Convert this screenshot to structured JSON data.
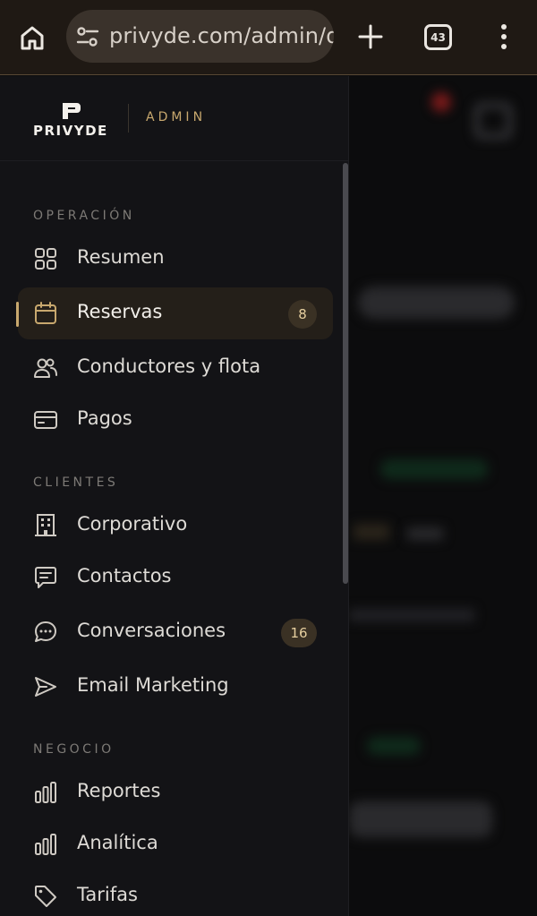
{
  "browser": {
    "url": "privyde.com/admin/da",
    "tab_count": "43"
  },
  "drawer": {
    "logo_text": "PRIVYDE",
    "admin_label": "ADMIN",
    "sections": [
      {
        "label": "OPERACIÓN",
        "items": [
          {
            "label": "Resumen",
            "icon": "grid-icon"
          },
          {
            "label": "Reservas",
            "icon": "calendar-icon",
            "badge": "8",
            "active": true
          },
          {
            "label": "Conductores y flota",
            "icon": "users-icon"
          },
          {
            "label": "Pagos",
            "icon": "credit-card-icon"
          }
        ]
      },
      {
        "label": "CLIENTES",
        "items": [
          {
            "label": "Corporativo",
            "icon": "building-icon"
          },
          {
            "label": "Contactos",
            "icon": "message-square-icon"
          },
          {
            "label": "Conversaciones",
            "icon": "chat-bubble-icon",
            "badge": "16"
          },
          {
            "label": "Email Marketing",
            "icon": "send-icon"
          }
        ]
      },
      {
        "label": "NEGOCIO",
        "items": [
          {
            "label": "Reportes",
            "icon": "bar-chart-icon"
          },
          {
            "label": "Analítica",
            "icon": "bar-chart-icon"
          },
          {
            "label": "Tarifas",
            "icon": "tag-icon"
          }
        ]
      }
    ]
  },
  "colors": {
    "accent": "#c8a86e",
    "drawer_bg": "#131316",
    "active_bg": "#241f19"
  }
}
